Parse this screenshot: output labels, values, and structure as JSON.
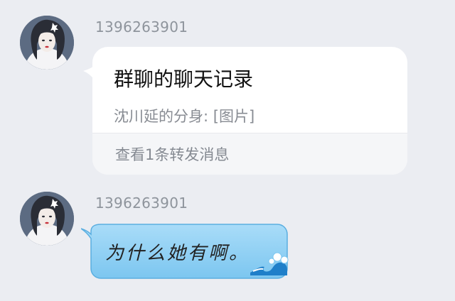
{
  "messages": [
    {
      "sender": "1396263901",
      "type": "forwarded",
      "title": "群聊的聊天记录",
      "preview": "沈川延的分身: [图片]",
      "footer": "查看1条转发消息"
    },
    {
      "sender": "1396263901",
      "type": "text",
      "text": "为什么她有啊。"
    }
  ],
  "colors": {
    "background": "#ebedf2",
    "card": "#ffffff",
    "bubble": "#8fd0f5"
  },
  "icons": {
    "avatar": "avatar-girl-icon",
    "bubble_decoration": "wave-icon"
  }
}
